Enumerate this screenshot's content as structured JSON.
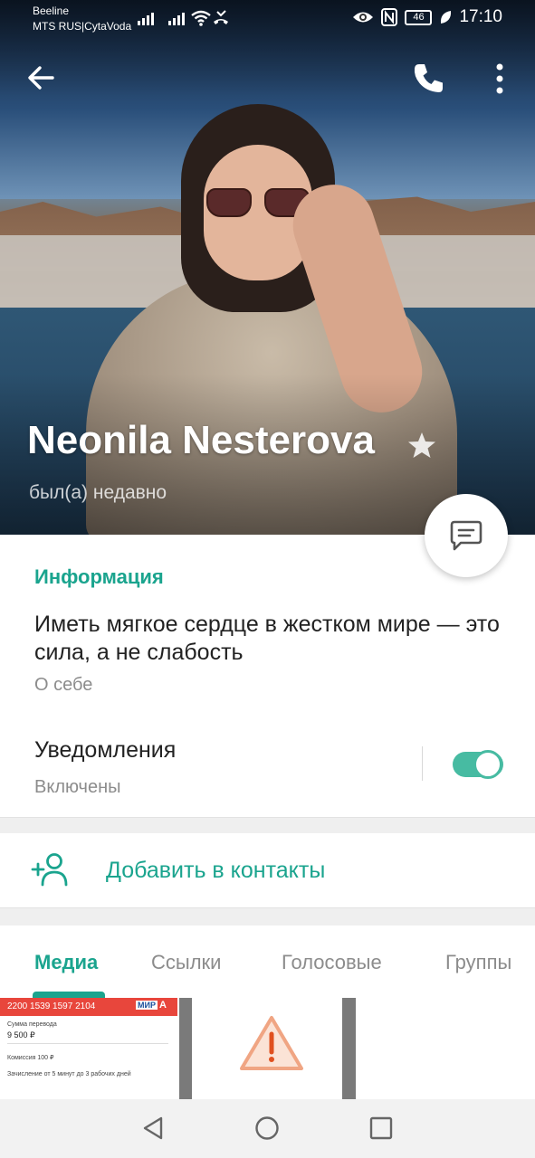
{
  "status_bar": {
    "carrier_1": "Beeline",
    "carrier_2": "MTS RUS|CytaVoda",
    "battery": "46",
    "time": "17:10"
  },
  "header": {
    "name": "Neonila Nesterova",
    "last_seen": "был(а) недавно",
    "icons": [
      "back-arrow-icon",
      "phone-icon",
      "more-vertical-icon",
      "star-icon",
      "message-icon"
    ]
  },
  "info": {
    "section_title": "Информация",
    "bio": "Иметь мягкое сердце в жестком мире — это сила, а не слабость",
    "bio_caption": "О себе",
    "notifications_label": "Уведомления",
    "notifications_status": "Включены",
    "notifications_enabled": true
  },
  "add_contact": {
    "label": "Добавить в контакты"
  },
  "tabs": [
    {
      "label": "Медиа",
      "active": true
    },
    {
      "label": "Ссылки",
      "active": false
    },
    {
      "label": "Голосовые",
      "active": false
    },
    {
      "label": "Группы",
      "active": false
    }
  ],
  "media": {
    "transfer_card": {
      "card_number": "2200 1539 1597 2104",
      "brand": "МИР",
      "brand_mark": "А",
      "amount_label": "Сумма перевода",
      "amount": "9 500 ₽",
      "commission": "Комиссия 100 ₽",
      "note": "Зачисление от 5 минут до 3 рабочих дней"
    }
  },
  "colors": {
    "accent": "#1aa48e",
    "toggle": "#47bba2",
    "secondary_text": "#8c8c8c"
  }
}
